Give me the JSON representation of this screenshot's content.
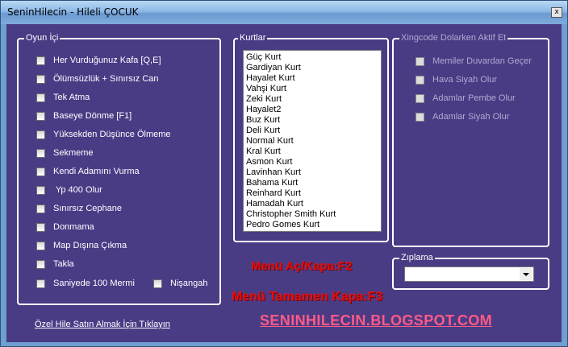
{
  "window": {
    "title": "SeninHilecin - Hileli ÇOCUK",
    "close_glyph": "x"
  },
  "oyun_ici": {
    "label": "Oyun İçi",
    "items": [
      "Her Vurduğunuz Kafa [Q,E]",
      "Ölümsüzlük + Sınırsız Can",
      "Tek Atma",
      "Baseye Dönme [F1]",
      "Yüksekden Düşünce Ölmeme",
      "Sekmeme",
      "Kendi Adamını Vurma",
      " Yp 400 Olur",
      "Sınırsız Cephane",
      "Donmama",
      "Map Dışına Çıkma",
      "Takla",
      "Saniyede 100 Mermi"
    ],
    "extra_item": "Nişangah"
  },
  "kurtlar": {
    "label": "Kurtlar",
    "items": [
      "Güç Kurt",
      "Gardiyan Kurt",
      "Hayalet Kurt",
      "Vahşi Kurt",
      "Zeki Kurt",
      "Hayalet2",
      "Buz Kurt",
      "Deli Kurt",
      "Normal Kurt",
      "Kral Kurt",
      "Asmon Kurt",
      "Lavinhan Kurt",
      "Bahama Kurt",
      "Reinhard Kurt",
      "Hamadah Kurt",
      "Christopher Smith Kurt",
      "Pedro Gomes Kurt"
    ]
  },
  "xingcode": {
    "label": "Xingcode Dolarken Aktif Et",
    "items": [
      "Memiler Duvardan Geçer",
      "Hava Siyah Olur",
      "Adamlar Pembe Olur",
      "Adamlar Siyah Olur"
    ]
  },
  "ziplama": {
    "label": "Zıplama",
    "value": ""
  },
  "hints": {
    "toggle": "Menü Aç/Kapa:F2",
    "close": "Menü Tamamen Kapa:F3"
  },
  "footer": {
    "link": "Özel Hile Satın Almak İçin Tıklayın",
    "blog": "SENINHILECIN.BLOGSPOT.COM"
  },
  "colors": {
    "client_bg": "#4a3b85",
    "hint_red": "#e01010",
    "blog_pink": "#ff5a86"
  }
}
